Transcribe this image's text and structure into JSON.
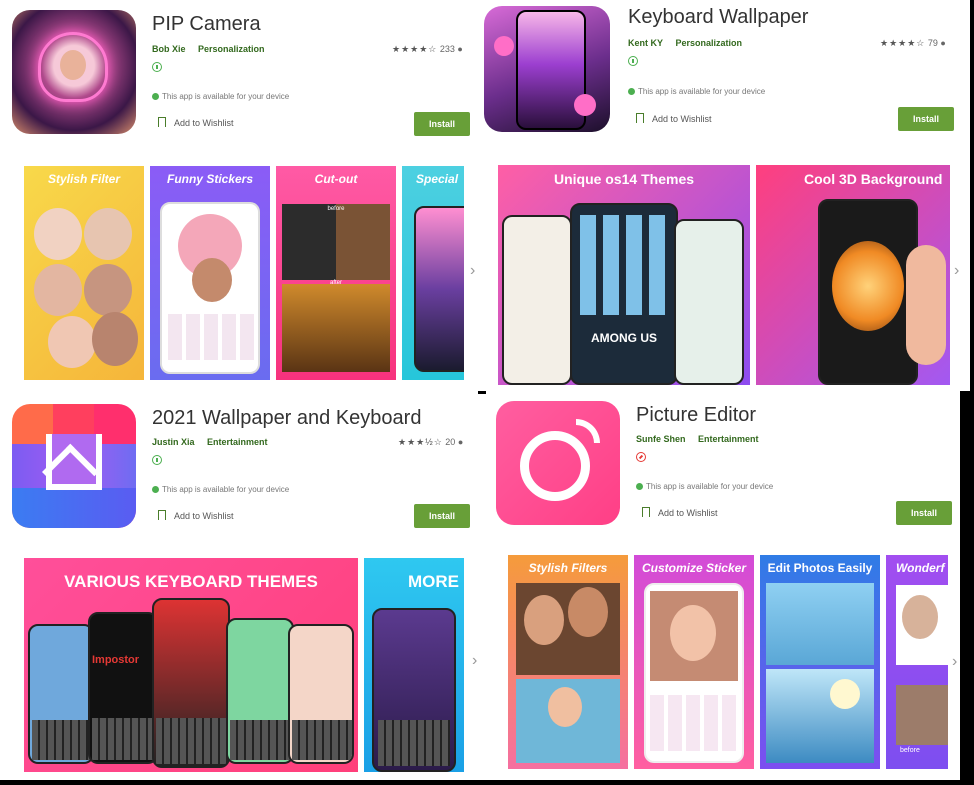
{
  "apps": [
    {
      "title": "PIP Camera",
      "developer": "Bob Xie",
      "category": "Personalization",
      "stars": "★★★★☆",
      "rating_count": "233",
      "availability": "This app is available for your device",
      "wishlist": "Add to Wishlist",
      "install": "Install",
      "screens": [
        "Stylish Filter",
        "Funny Stickers",
        "Cut-out",
        "Special"
      ],
      "screen_sub": [
        "before",
        "after"
      ]
    },
    {
      "title": "Keyboard Wallpaper",
      "developer": "Kent KY",
      "category": "Personalization",
      "stars": "★★★★☆",
      "rating_count": "79",
      "availability": "This app is available for your device",
      "wishlist": "Add to Wishlist",
      "install": "Install",
      "screens": [
        "Unique os14 Themes",
        "Cool 3D Background"
      ],
      "screen_sub": [
        "AMONG US"
      ]
    },
    {
      "title": "2021 Wallpaper and Keyboard",
      "developer": "Justin Xia",
      "category": "Entertainment",
      "stars": "★★★½☆",
      "rating_count": "20",
      "availability": "This app is available for your device",
      "wishlist": "Add to Wishlist",
      "install": "Install",
      "screens": [
        "VARIOUS KEYBOARD THEMES",
        "MORE"
      ],
      "screen_sub": [
        "Impostor"
      ]
    },
    {
      "title": "Picture Editor",
      "developer": "Sunfe Shen",
      "category": "Entertainment",
      "availability": "This app is available for your device",
      "wishlist": "Add to Wishlist",
      "install": "Install",
      "screens": [
        "Stylish Filters",
        "Customize Sticker",
        "Edit Photos Easily",
        "Wonderf"
      ],
      "screen_sub": [
        "before"
      ]
    }
  ],
  "colors": {
    "install": "#689f38",
    "meta": "#33691e",
    "available": "#4caf50"
  },
  "icons": [
    "person-icon",
    "bookmark-icon",
    "chevron-right-icon",
    "check-circle-icon"
  ]
}
